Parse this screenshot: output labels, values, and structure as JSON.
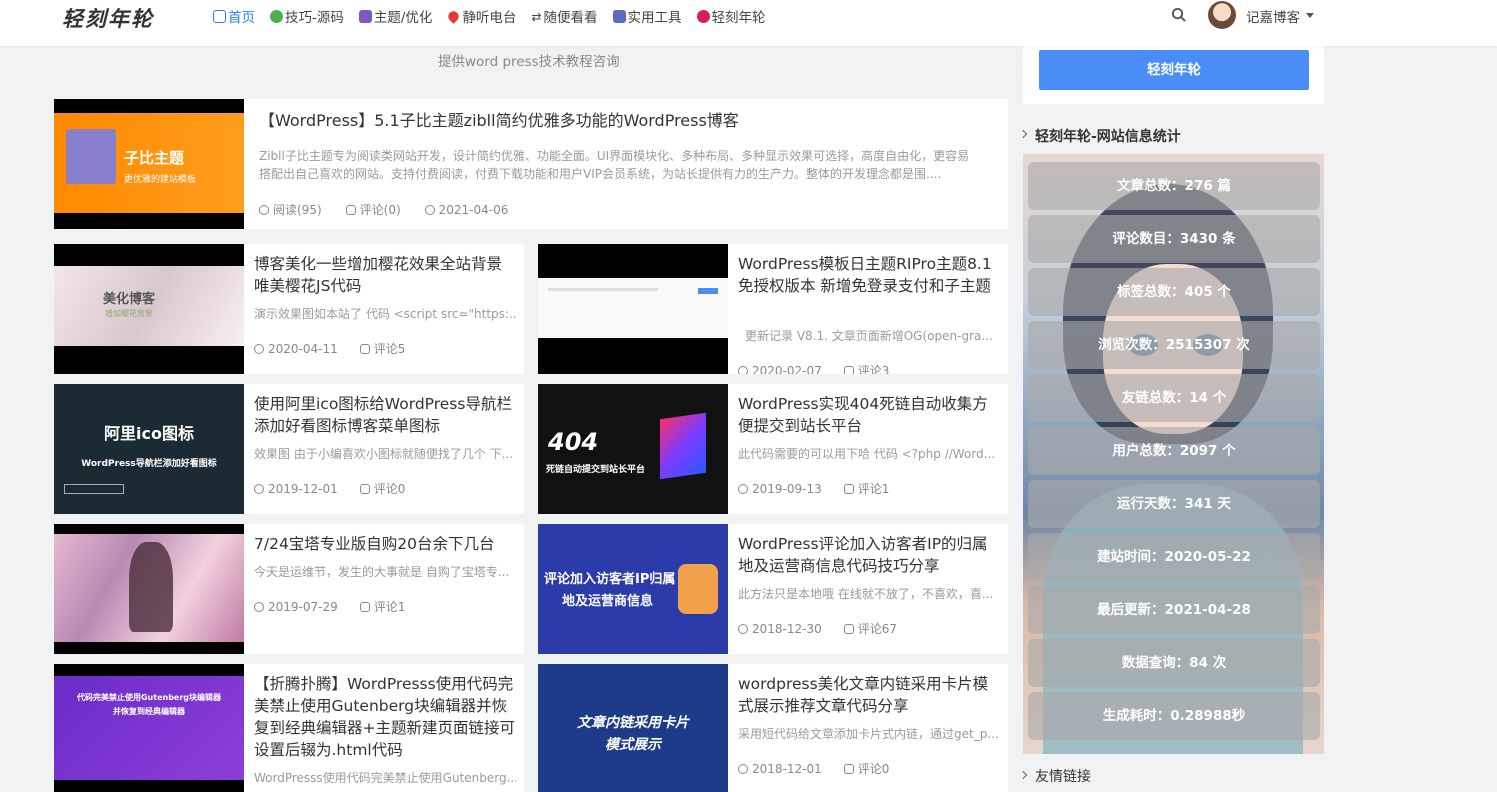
{
  "header": {
    "logo": "轻刻年轮",
    "nav": [
      {
        "label": "首页",
        "icon": "home-icon",
        "color": "#2f7df6",
        "active": true
      },
      {
        "label": "技巧-源码",
        "icon": "globe-icon",
        "color": "#4caf50"
      },
      {
        "label": "主题/优化",
        "icon": "palette-icon",
        "color": "#7e57c2"
      },
      {
        "label": "静听电台",
        "icon": "heart-icon",
        "color": "#e53935"
      },
      {
        "label": "随便看看",
        "icon": "shuffle-icon",
        "color": "#333333"
      },
      {
        "label": "实用工具",
        "icon": "toolbox-icon",
        "color": "#5c6bc0"
      },
      {
        "label": "轻刻年轮",
        "icon": "rose-icon",
        "color": "#d81b60"
      }
    ],
    "user_name": "记嘉博客"
  },
  "subtitle": "提供word press技术教程咨询",
  "featured": {
    "title": "【WordPress】5.1子比主题zibll简约优雅多功能的WordPress博客",
    "excerpt": "Zibll子比主题专为阅读类网站开发，设计简约优雅、功能全面。UI界面模块化、多种布局、多种显示效果可选择，高度自由化，更容易搭配出自己喜欢的网站。支持付费阅读，付费下载功能和用户VIP会员系统，为站长提供有力的生产力。整体的开发理念都是围....",
    "views": "阅读(95)",
    "comments": "评论(0)",
    "date": "2021-04-06",
    "thumb_text": "子比主题",
    "thumb_sub": "更优雅的建站模板"
  },
  "posts": [
    {
      "title": "博客美化一些增加樱花效果全站背景唯美樱花JS代码",
      "excerpt": "演示效果图如本站了 代码 <script src=\"https:...",
      "date": "2020-04-11",
      "comments": "评论5",
      "thumb_text": "美化博客",
      "thumb_sub": "增加樱花背景"
    },
    {
      "title": "WordPress模板日主题RIPro主题8.1免授权版本 新增免登录支付和子主题",
      "excerpt": "更新记录 V8.1. 文章页面新增OG(open-gra...",
      "date": "2020-02-07",
      "comments": "评论3",
      "thumb_text": "",
      "thumb_sub": ""
    },
    {
      "title": "使用阿里ico图标给WordPress导航栏添加好看图标博客菜单图标",
      "excerpt": "效果图 由于小编喜欢小图标就随便找了几个 下...",
      "date": "2019-12-01",
      "comments": "评论0",
      "thumb_text": "阿里ico图标",
      "thumb_sub": "WordPress导航栏添加好看图标"
    },
    {
      "title": "WordPress实现404死链自动收集方便提交到站长平台",
      "excerpt": "此代码需要的可以用下哈 代码 <?php //Word...",
      "date": "2019-09-13",
      "comments": "评论1",
      "thumb_text": "404",
      "thumb_sub": "死链自动提交到站长平台"
    },
    {
      "title": "7/24宝塔专业版自购20台余下几台",
      "excerpt": "今天是运维节，发生的大事就是 自购了宝塔专...",
      "date": "2019-07-29",
      "comments": "评论1",
      "thumb_text": "",
      "thumb_sub": ""
    },
    {
      "title": "WordPress评论加入访客者IP的归属地及运营商信息代码技巧分享",
      "excerpt": "此方法只是本地哦 在线就不放了，不喜欢，喜...",
      "date": "2018-12-30",
      "comments": "评论67",
      "thumb_text": "评论加入访客者IP归属",
      "thumb_sub": "地及运营商信息"
    },
    {
      "title": "【折腾扑腾】WordPresss使用代码完美禁止使用Gutenberg块编辑器并恢复到经典编辑器+主题新建页面链接可设置后辍为.html代码",
      "excerpt": "WordPresss使用代码完美禁止使用Gutenberg...",
      "date": "",
      "comments": "",
      "thumb_text": "代码完美禁止使用Gutenberg块编辑器",
      "thumb_sub": "并恢复到经典编辑器"
    },
    {
      "title": "wordpress美化文章内链采用卡片模式展示推荐文章代码分享",
      "excerpt": "采用短代码给文章添加卡片式内链，通过get_p...",
      "date": "2018-12-01",
      "comments": "评论0",
      "thumb_text": "文章内链采用卡片",
      "thumb_sub": "模式展示"
    }
  ],
  "sidebar": {
    "button": "轻刻年轮",
    "stats_title": "轻刻年轮-网站信息统计",
    "stats": [
      "文章总数：276 篇",
      "评论数目：3430 条",
      "标签总数：405 个",
      "浏览次数：2515307 次",
      "友链总数：14 个",
      "用户总数：2097 个",
      "运行天数：341 天",
      "建站时间：2020-05-22",
      "最后更新：2021-04-28",
      "数据查询：84 次",
      "生成耗时：0.28988秒"
    ],
    "links_title": "友情链接"
  }
}
